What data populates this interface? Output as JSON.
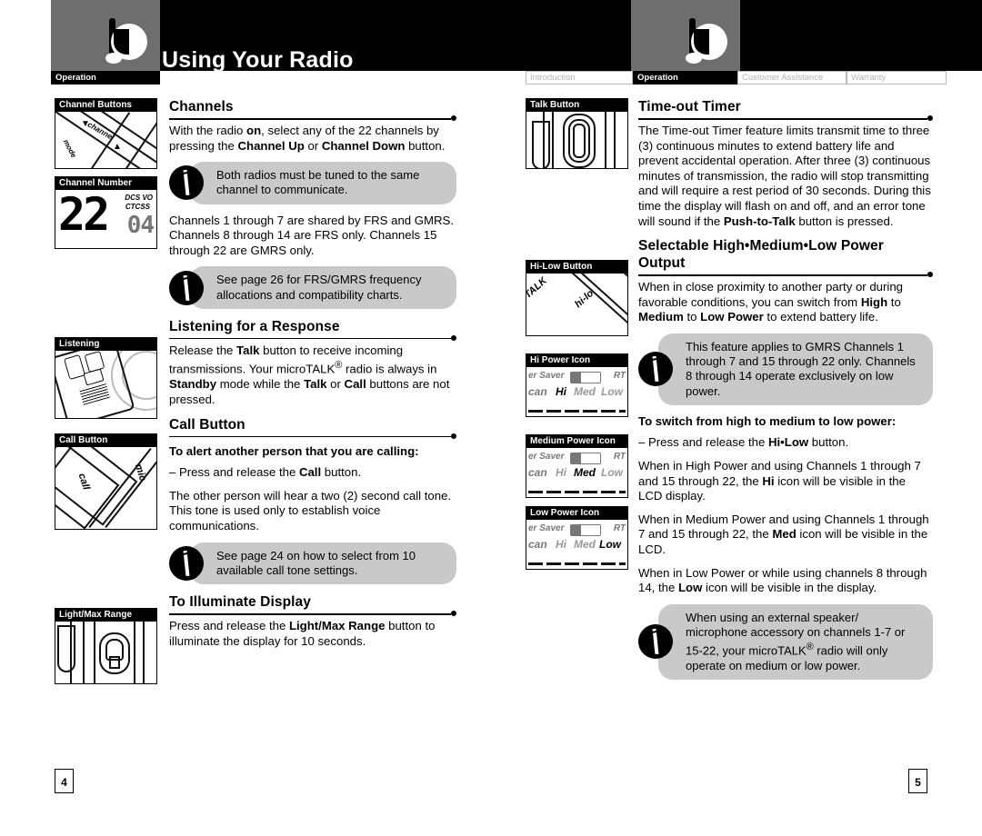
{
  "header": {
    "title": "Using Your Radio",
    "logo_icon": "cobra-logo-icon",
    "left_tab_label": "Operation",
    "tabs": [
      {
        "label": "Introduction",
        "active": false
      },
      {
        "label": "Operation",
        "active": true
      },
      {
        "label": "Customer Assistance",
        "active": false
      },
      {
        "label": "Warranty",
        "active": false
      }
    ]
  },
  "left_page": {
    "page_number": "4",
    "figures": [
      {
        "caption": "Channel Buttons",
        "labels": [
          "channel",
          "mode"
        ]
      },
      {
        "caption": "Channel Number",
        "labels": [
          "22",
          "DCS VO",
          "CTCSS",
          "04"
        ]
      },
      {
        "caption": "Listening",
        "labels": []
      },
      {
        "caption": "Call Button",
        "labels": [
          "call",
          "mic"
        ]
      },
      {
        "caption": "Light/Max Range",
        "labels": []
      }
    ],
    "sections": [
      {
        "heading": "Channels",
        "blocks": [
          {
            "type": "p",
            "html": "With the radio <b>on</b>, select any of the 22 channels by pressing the <b>Channel Up</b> or <b>Channel Down</b> button."
          },
          {
            "type": "tip",
            "html": "Both radios must be tuned to the same channel to communicate."
          },
          {
            "type": "p",
            "html": "Channels 1 through 7 are shared by FRS and GMRS. Channels 8 through 14 are FRS only. Channels 15 through 22 are GMRS only."
          },
          {
            "type": "tip",
            "html": "See page 26 for FRS/GMRS frequency allocations and compatibility charts."
          }
        ]
      },
      {
        "heading": "Listening for a Response",
        "blocks": [
          {
            "type": "p",
            "html": "Release the <b>Talk</b> button to receive incoming transmissions. Your microTALK<sup>&reg;</sup> radio is always in <b>Standby</b> mode while the <b>Talk</b> or <b>Call</b> buttons are not pressed."
          }
        ]
      },
      {
        "heading": "Call Button",
        "blocks": [
          {
            "type": "sub",
            "html": "To alert another person that you are calling:"
          },
          {
            "type": "p",
            "html": "&ndash; Press and release the <b>Call</b> button."
          },
          {
            "type": "p",
            "html": "The other person will hear a two (2) second call tone. This tone is used only to establish voice communications."
          },
          {
            "type": "tip",
            "html": "See page 24 on how to select from 10 available call tone settings."
          }
        ]
      },
      {
        "heading": "To Illuminate Display",
        "blocks": [
          {
            "type": "p",
            "html": "Press and release the <b>Light/Max Range</b> button to illuminate the display for 10 seconds."
          }
        ]
      }
    ]
  },
  "right_page": {
    "page_number": "5",
    "figures": [
      {
        "caption": "Talk Button",
        "labels": []
      },
      {
        "caption": "Hi-Low Button",
        "labels": [
          "TALK",
          "hi-lo"
        ]
      },
      {
        "caption": "Hi Power Icon",
        "labels": [
          "er Saver",
          "RT",
          "can",
          "Hi",
          "Med",
          "Low"
        ],
        "active": "Hi"
      },
      {
        "caption": "Medium Power Icon",
        "labels": [
          "er Saver",
          "RT",
          "can",
          "Hi",
          "Med",
          "Low"
        ],
        "active": "Med"
      },
      {
        "caption": "Low Power Icon",
        "labels": [
          "er Saver",
          "RT",
          "can",
          "Hi",
          "Med",
          "Low"
        ],
        "active": "Low"
      }
    ],
    "sections": [
      {
        "heading": "Time-out Timer",
        "blocks": [
          {
            "type": "p",
            "html": "The Time-out Timer feature limits transmit time to three (3) continuous minutes to extend battery life and prevent accidental operation. After three (3) continuous minutes of transmission, the radio will stop transmitting and will require a rest period of 30 seconds. During this time the display will flash on and off, and an error tone will sound if the <b>Push-to-Talk</b> button is pressed."
          }
        ]
      },
      {
        "heading": "Selectable High•Medium•Low Power Output",
        "blocks": [
          {
            "type": "p",
            "html": "When in close proximity to another party or during favorable conditions, you can switch from <b>High</b> to <b>Medium</b> to <b>Low Power</b> to extend battery life."
          },
          {
            "type": "tip",
            "html": "This feature applies to GMRS Channels 1 through 7 and 15 through 22 only. Channels 8 through 14 operate exclusively on low power."
          },
          {
            "type": "sub",
            "html": "To switch from high to medium to low power:"
          },
          {
            "type": "p",
            "html": "&ndash; Press and release the <b>Hi&bull;Low</b> button."
          },
          {
            "type": "p",
            "html": "When in High Power and using Channels 1 through 7 and 15 through 22, the <b>Hi</b> icon will be visible in the LCD display."
          },
          {
            "type": "p",
            "html": "When in Medium Power and using Channels 1 through 7 and 15 through 22, the <b>Med</b> icon will be visible in the LCD."
          },
          {
            "type": "p",
            "html": "When in Low Power or while using channels 8 through 14, the <b>Low</b> icon will be visible in the display."
          },
          {
            "type": "tip",
            "html": "When using an external speaker/ microphone accessory on channels 1-7 or 15-22, your microTALK<sup>&reg;</sup> radio will only operate on medium or low power."
          }
        ]
      }
    ]
  },
  "colors": {
    "band": "#000000",
    "tab_block": "#6e6e6e",
    "tip_bubble": "#c9c9c9",
    "inactive_tab_text": "#b4b4b4"
  }
}
